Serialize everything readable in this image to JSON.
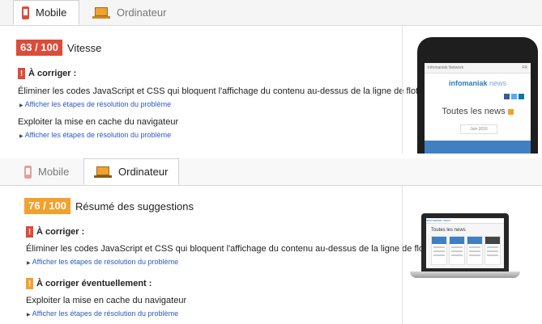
{
  "mobile_panel": {
    "tabs": [
      {
        "label": "Mobile",
        "icon": "phone-icon",
        "active": true
      },
      {
        "label": "Ordinateur",
        "icon": "laptop-icon",
        "active": false
      }
    ],
    "score": {
      "value": "63 / 100",
      "title": "Vitesse",
      "color": "#dd4b39"
    },
    "sections": [
      {
        "heading": "À corriger :",
        "color": "#dd4b39",
        "rules": [
          {
            "text": "Éliminer les codes JavaScript et CSS qui bloquent l'affichage du contenu au-dessus de la ligne de flottaison",
            "link": "Afficher les étapes de résolution du problème"
          }
        ]
      }
    ],
    "extra_rule": {
      "text": "Exploiter la mise en cache du navigateur",
      "link": "Afficher les étapes de résolution du problème"
    },
    "preview": {
      "topbar_left": "Infomaniak Network",
      "topbar_right": "FR",
      "logo_main": "infomaniak",
      "logo_suffix": "news",
      "headline": "Toutes les news",
      "date": "Juin 2016"
    }
  },
  "desktop_panel": {
    "tabs": [
      {
        "label": "Mobile",
        "icon": "phone-icon",
        "active": false
      },
      {
        "label": "Ordinateur",
        "icon": "laptop-icon",
        "active": true
      }
    ],
    "score": {
      "value": "76 / 100",
      "title": "Résumé des suggestions",
      "color": "#f2a12e"
    },
    "sections": [
      {
        "heading": "À corriger :",
        "color": "#dd4b39",
        "rules": [
          {
            "text": "Éliminer les codes JavaScript et CSS qui bloquent l'affichage du contenu au-dessus de la ligne de flottaison",
            "link": "Afficher les étapes de résolution du problème"
          }
        ]
      },
      {
        "heading": "À corriger éventuellement :",
        "color": "#f2a12e",
        "rules": [
          {
            "text": "Exploiter la mise en cache du navigateur",
            "link": "Afficher les étapes de résolution du problème"
          }
        ]
      }
    ],
    "preview": {
      "logo": "infomaniak news",
      "headline": "Toutes les news"
    }
  }
}
